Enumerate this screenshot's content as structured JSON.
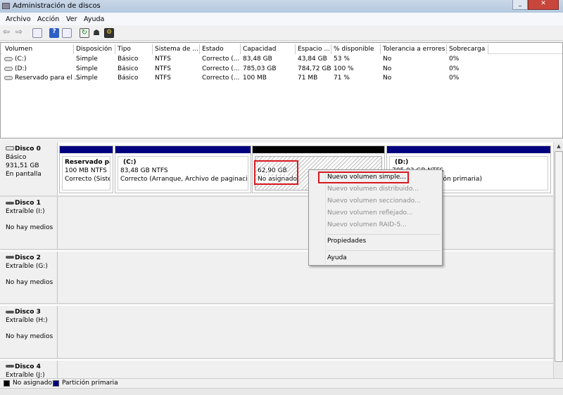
{
  "window": {
    "title": "Administración de discos"
  },
  "menu": [
    "Archivo",
    "Acción",
    "Ver",
    "Ayuda"
  ],
  "toolbar": [
    "back-icon",
    "forward-icon",
    "show-hide-console-icon",
    "help-icon",
    "action-pane-icon",
    "refresh-icon",
    "properties-icon",
    "rescan-icon"
  ],
  "volumes": {
    "columns": [
      "Volumen",
      "Disposición",
      "Tipo",
      "Sistema de ...",
      "Estado",
      "Capacidad",
      "Espacio ...",
      "% disponible",
      "Tolerancia a errores",
      "Sobrecarga"
    ],
    "rows": [
      [
        "(C:)",
        "Simple",
        "Básico",
        "NTFS",
        "Correcto (...",
        "83,48 GB",
        "43,84 GB",
        "53 %",
        "No",
        "0%"
      ],
      [
        "(D:)",
        "Simple",
        "Básico",
        "NTFS",
        "Correcto (...",
        "785,03 GB",
        "784,72 GB",
        "100 %",
        "No",
        "0%"
      ],
      [
        "Reservado para el ...",
        "Simple",
        "Básico",
        "NTFS",
        "Correcto (...",
        "100 MB",
        "71 MB",
        "71 %",
        "No",
        "0%"
      ]
    ]
  },
  "disks": [
    {
      "name": "Disco 0",
      "type": "Básico",
      "size": "931,51 GB",
      "status": "En pantalla",
      "partitions": [
        {
          "title": "Reservado para",
          "size": "100 MB NTFS",
          "status": "Correcto (Sistem"
        },
        {
          "title": "(C:)",
          "size": "83,48 GB NTFS",
          "status": "Correcto (Arranque, Archivo de paginación, '"
        },
        {
          "title": "",
          "size": "62,90 GB",
          "status": "No asignado"
        },
        {
          "title": "(D:)",
          "size": "785,03 GB NTFS",
          "status": "Correcto (Partición primaria)"
        }
      ]
    },
    {
      "name": "Disco 1",
      "type": "Extraíble (I:)",
      "status": "No hay medios"
    },
    {
      "name": "Disco 2",
      "type": "Extraíble (G:)",
      "status": "No hay medios"
    },
    {
      "name": "Disco 3",
      "type": "Extraíble (H:)",
      "status": "No hay medios"
    },
    {
      "name": "Disco 4",
      "type": "Extraíble (J:)"
    }
  ],
  "context_menu": [
    {
      "label": "Nuevo volumen simple...",
      "enabled": true
    },
    {
      "label": "Nuevo volumen distribuido...",
      "enabled": false
    },
    {
      "label": "Nuevo volumen seccionado...",
      "enabled": false
    },
    {
      "label": "Nuevo volumen reflejado...",
      "enabled": false
    },
    {
      "label": "Nuevo volumen RAID-5...",
      "enabled": false
    },
    {
      "label": "Propiedades",
      "enabled": true
    },
    {
      "label": "Ayuda",
      "enabled": true
    }
  ],
  "legend": [
    {
      "label": "No asignado",
      "color": "#000000"
    },
    {
      "label": "Partición primaria",
      "color": "#00007f"
    }
  ]
}
